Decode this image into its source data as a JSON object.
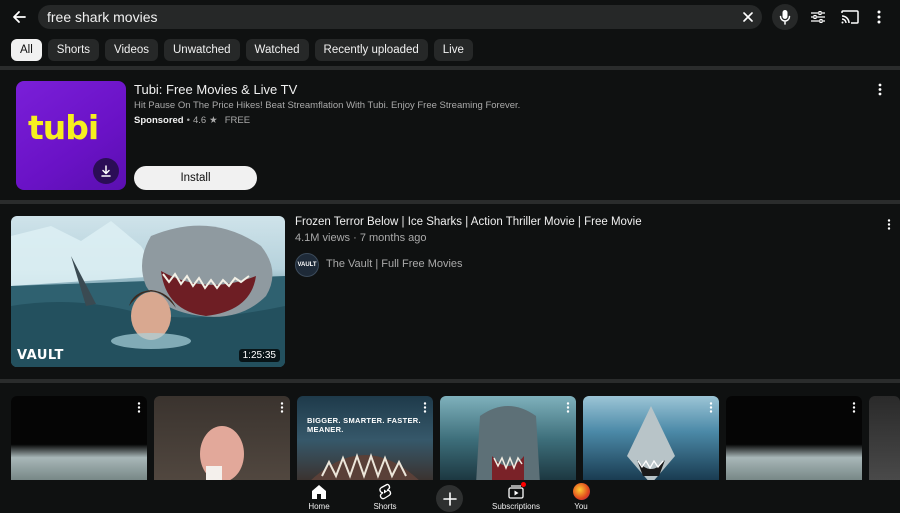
{
  "search": {
    "query": "free shark movies"
  },
  "chips": [
    "All",
    "Shorts",
    "Videos",
    "Unwatched",
    "Watched",
    "Recently uploaded",
    "Live"
  ],
  "ad": {
    "logo": "tubi",
    "title": "Tubi: Free Movies & Live TV",
    "description": "Hit Pause On The Price Hikes! Beat Streamflation With Tubi. Enjoy Free Streaming Forever.",
    "sponsored": "Sponsored",
    "rating": "4.6",
    "star": "★",
    "price": "FREE",
    "install_label": "Install"
  },
  "video": {
    "title": "Frozen Terror Below | Ice Sharks | Action Thriller Movie | Free Movie",
    "views": "4.1M views",
    "age": "7 months ago",
    "channel": "The Vault | Full Free Movies",
    "channel_avatar_text": "VAULT",
    "duration": "1:25:35",
    "thumb_mark": "VAULT"
  },
  "shorts": [
    {
      "caption": ""
    },
    {
      "caption": ""
    },
    {
      "caption": "BIGGER. SMARTER. FASTER. MEANER."
    },
    {
      "caption": ""
    },
    {
      "caption": ""
    },
    {
      "caption": ""
    }
  ],
  "nav": {
    "home": "Home",
    "shorts": "Shorts",
    "subscriptions": "Subscriptions",
    "you": "You"
  },
  "colors": {
    "background": "#0f1111",
    "chip": "#262828",
    "chip_active": "#f1f1f1",
    "tubi_purple": "#7a1fd8",
    "tubi_yellow": "#f6ef1f",
    "notification_red": "#ff0000"
  }
}
